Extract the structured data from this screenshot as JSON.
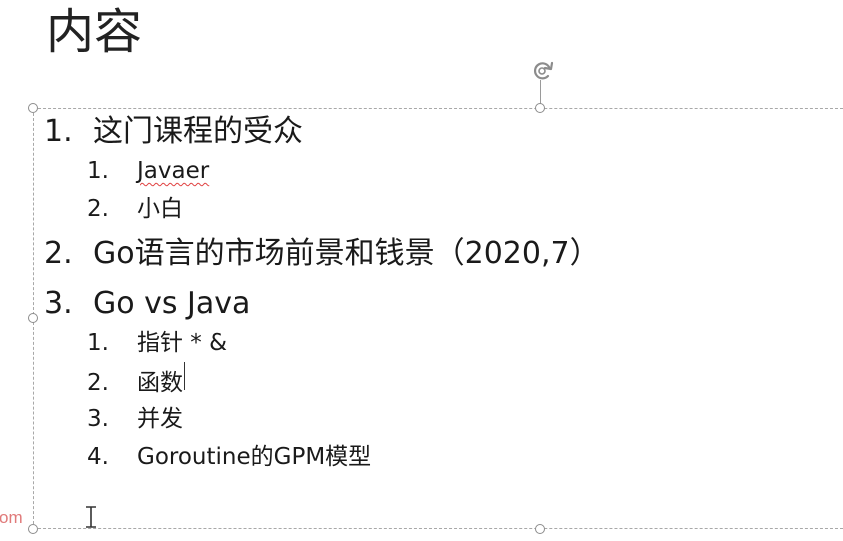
{
  "slide": {
    "title": "内容"
  },
  "outline": [
    {
      "num": "1.",
      "text": "这门课程的受众",
      "children": [
        {
          "num": "1.",
          "text": "Javaer"
        },
        {
          "num": "2.",
          "text": "小白"
        }
      ]
    },
    {
      "num": "2.",
      "text": "Go语言的市场前景和钱景（2020,7）",
      "children": []
    },
    {
      "num": "3.",
      "text": "Go vs Java",
      "children": [
        {
          "num": "1.",
          "text": "指针 * &"
        },
        {
          "num": "2.",
          "text": "函数"
        },
        {
          "num": "3.",
          "text": "并发"
        },
        {
          "num": "4.",
          "text": "Goroutine的GPM模型"
        }
      ]
    }
  ],
  "watermark": {
    "text": "om"
  },
  "icons": {
    "rotate": "rotate-handle-icon",
    "cursor": "text-cursor-icon"
  }
}
